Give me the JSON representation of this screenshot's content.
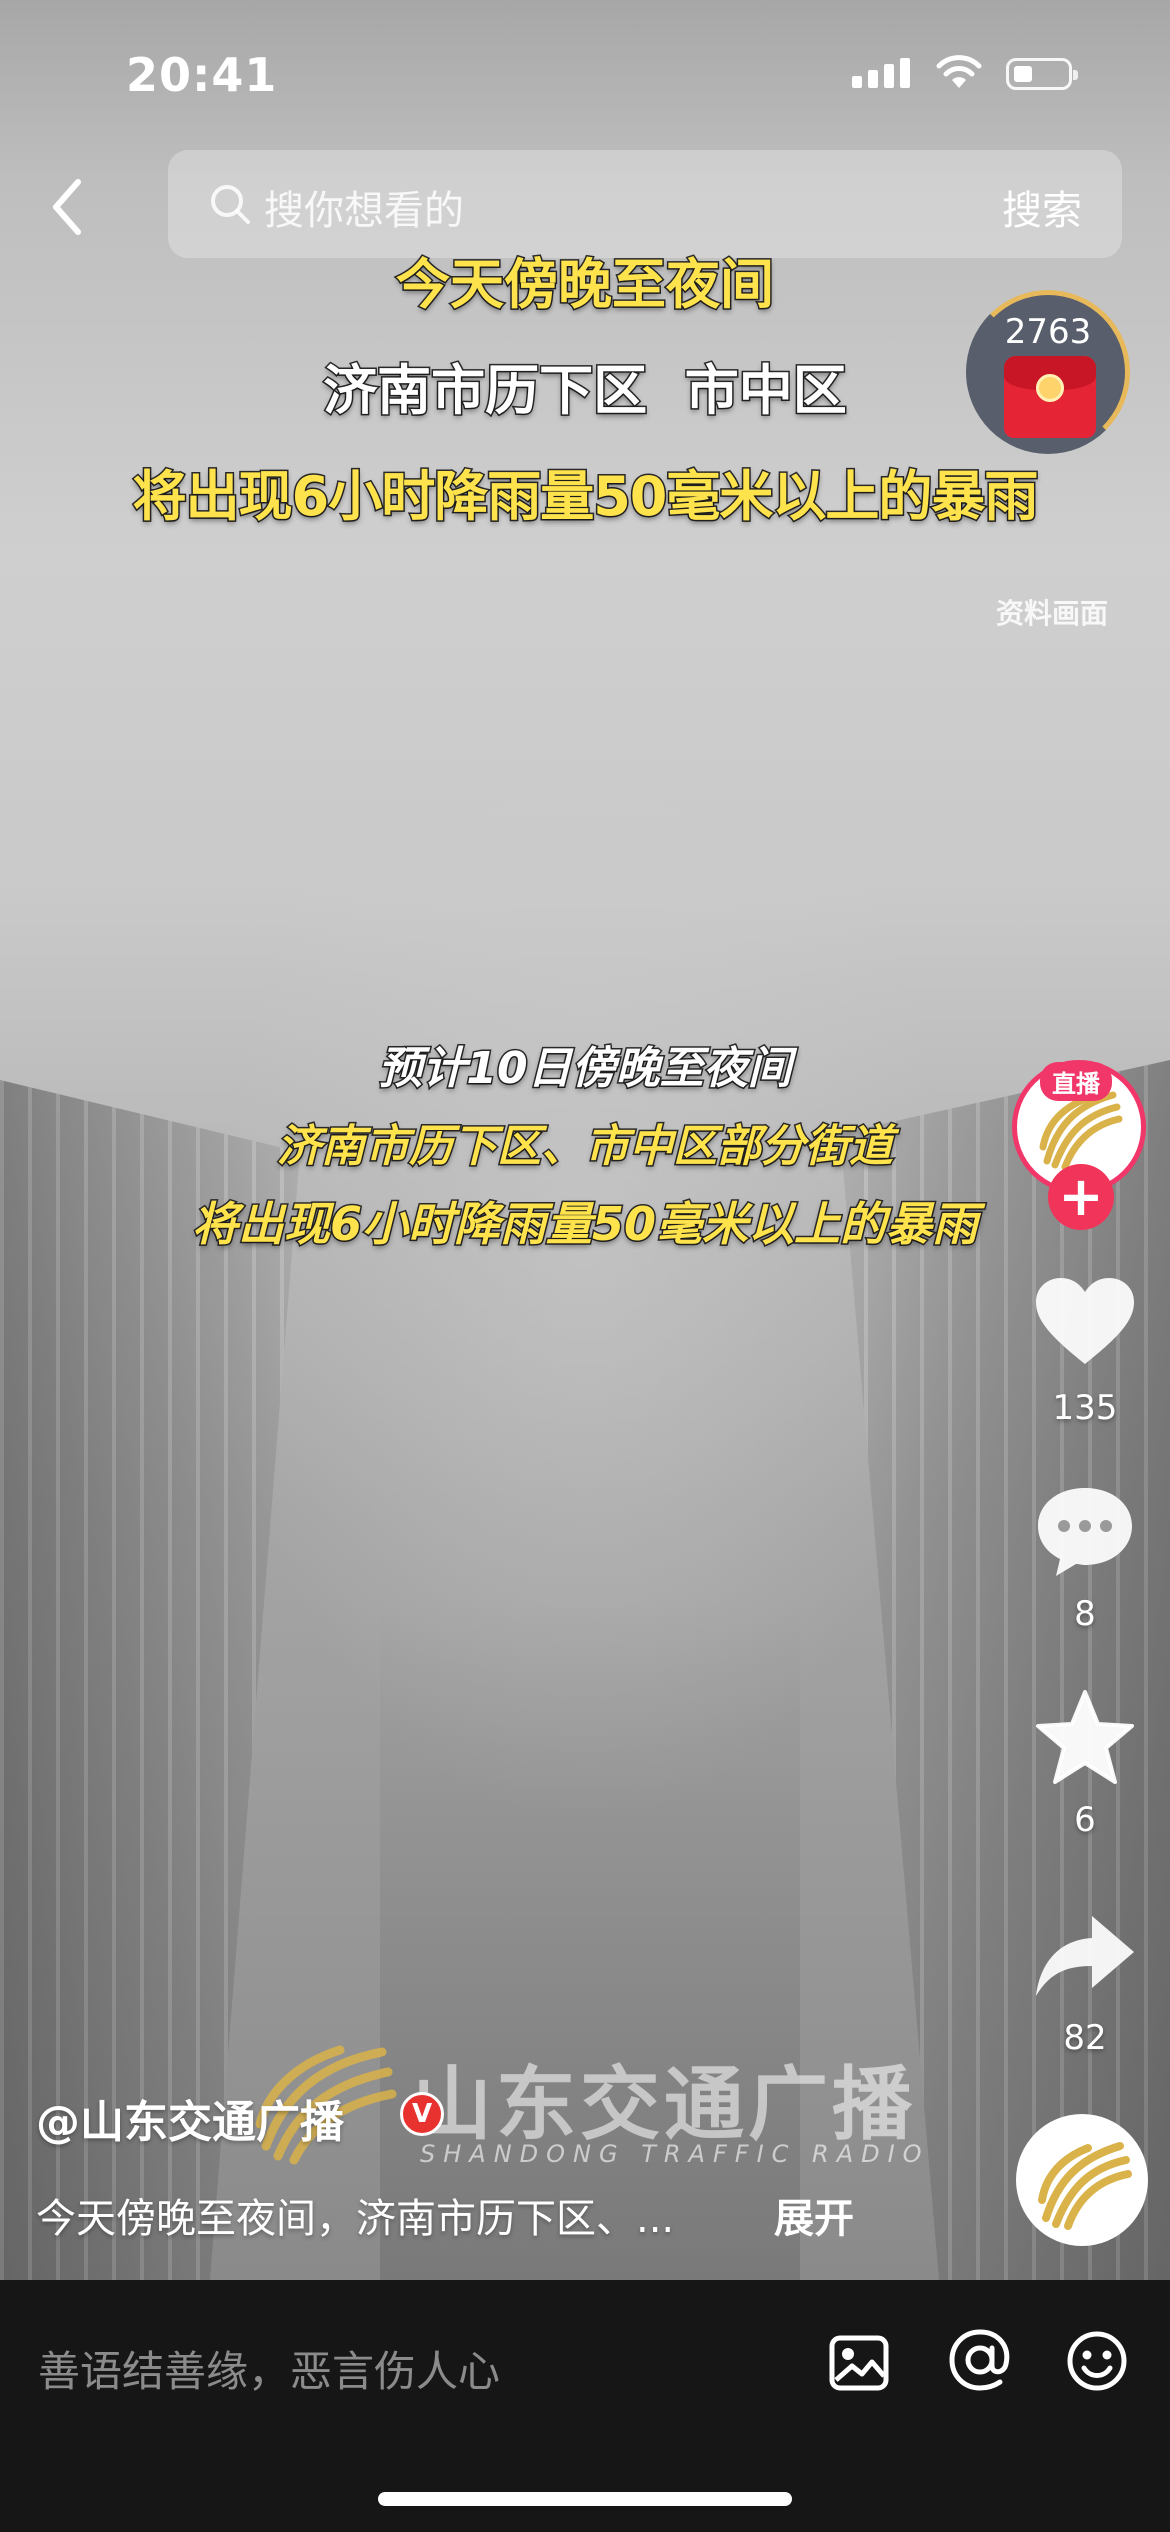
{
  "status_bar": {
    "time": "20:41"
  },
  "search": {
    "placeholder": "搜你想看的",
    "button_label": "搜索"
  },
  "video": {
    "top_captions": [
      "今天傍晚至夜间",
      "济南市历下区  市中区",
      "将出现6小时降雨量50毫米以上的暴雨"
    ],
    "watermark": "资料画面",
    "middle_captions": [
      "预计10日傍晚至夜间",
      "济南市历下区、市中区部分街道",
      "将出现6小时降雨量50毫米以上的暴雨"
    ],
    "brand_cn": "山东交通广播",
    "brand_en": "SHANDONG TRAFFIC RADIO"
  },
  "red_packet": {
    "count": "2763"
  },
  "rail": {
    "live_badge": "直播",
    "follow_label": "+",
    "like_count": "135",
    "comment_count": "8",
    "favorite_count": "6",
    "share_count": "82"
  },
  "post": {
    "author": "@山东交通广播",
    "verified_mark": "V",
    "description": "今天傍晚至夜间，济南市历下区、...",
    "expand_label": "展开"
  },
  "comment_bar": {
    "placeholder": "善语结善缘，恶言伤人心"
  },
  "colors": {
    "caption_yellow": "#ffe34d",
    "live_pink": "#f1366a",
    "verified_red": "#e8322f",
    "logo_gold": "#d9b24a"
  },
  "icons": [
    "back-icon",
    "search-icon",
    "heart-icon",
    "comment-icon",
    "star-icon",
    "share-icon",
    "image-icon",
    "at-icon",
    "emoji-icon",
    "signal-icon",
    "wifi-icon",
    "battery-icon"
  ]
}
